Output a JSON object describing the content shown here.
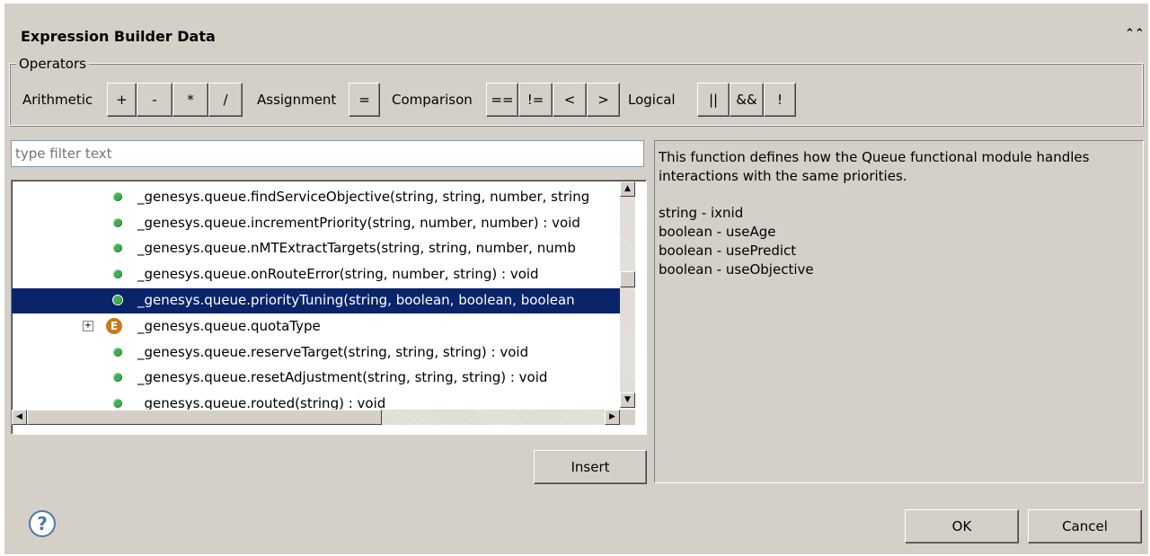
{
  "title": "Expression Builder Data",
  "operators": {
    "group_label": "Operators",
    "arithmetic_label": "Arithmetic",
    "arithmetic": [
      "+",
      "-",
      "*",
      "/"
    ],
    "assignment_label": "Assignment",
    "assignment": [
      "="
    ],
    "comparison_label": "Comparison",
    "comparison": [
      "==",
      "!=",
      "<",
      ">"
    ],
    "logical_label": "Logical",
    "logical": [
      "||",
      "&&",
      "!"
    ]
  },
  "filter": {
    "placeholder": "type filter text"
  },
  "tree": {
    "items": [
      {
        "label": "_genesys.queue.findServiceObjective(string, string, number, string",
        "icon": "function-bullet-icon"
      },
      {
        "label": "_genesys.queue.incrementPriority(string, number, number) : void",
        "icon": "function-bullet-icon"
      },
      {
        "label": "_genesys.queue.nMTExtractTargets(string, string, number, numb",
        "icon": "function-bullet-icon"
      },
      {
        "label": "_genesys.queue.onRouteError(string, number, string) : void",
        "icon": "function-bullet-icon"
      },
      {
        "label": "_genesys.queue.priorityTuning(string, boolean, boolean, boolean",
        "icon": "function-bullet-icon",
        "selected": true
      },
      {
        "label": "_genesys.queue.quotaType",
        "icon": "enum-icon",
        "enum_letter": "E"
      },
      {
        "label": "_genesys.queue.reserveTarget(string, string, string) : void",
        "icon": "function-bullet-icon"
      },
      {
        "label": "_genesys.queue.resetAdjustment(string, string, string) : void",
        "icon": "function-bullet-icon"
      },
      {
        "label": "_genesys.queue.routed(string) : void",
        "icon": "function-bullet-icon"
      }
    ]
  },
  "description": {
    "summary": "This function defines how the Queue functional module handles interactions with the same priorities.",
    "params": [
      "string - ixnid",
      "boolean - useAge",
      "boolean - usePredict",
      "boolean - useObjective"
    ]
  },
  "buttons": {
    "insert": "Insert",
    "ok": "OK",
    "cancel": "Cancel",
    "help": "?"
  },
  "colors": {
    "dialog_bg": "#d4d0c8",
    "selection": "#0a246a",
    "bullet": "#3fae55",
    "enum": "#c87a1e"
  }
}
